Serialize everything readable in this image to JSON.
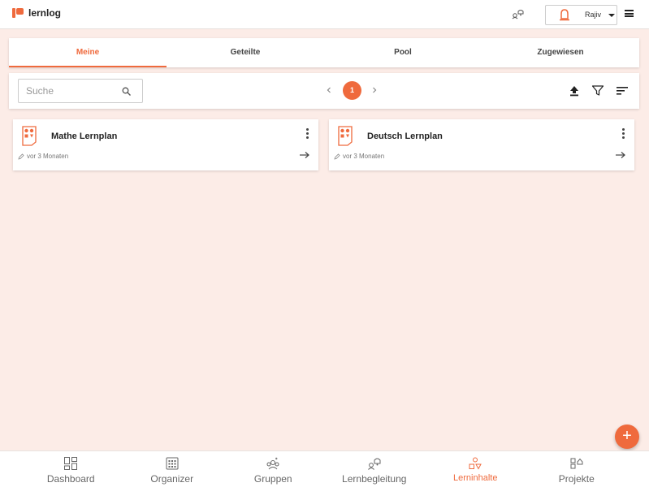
{
  "app": {
    "name": "lernlog"
  },
  "header": {
    "notification_icon": "notification-icon",
    "user_name": "Rajiv",
    "accent": "#ef6a3d"
  },
  "tabs": [
    {
      "label": "Meine",
      "active": true
    },
    {
      "label": "Geteilte",
      "active": false
    },
    {
      "label": "Pool",
      "active": false
    },
    {
      "label": "Zugewiesen",
      "active": false
    }
  ],
  "toolbar": {
    "search_placeholder": "Suche",
    "current_page": "1"
  },
  "cards": [
    {
      "title": "Mathe Lernplan",
      "updated": "vor 3 Monaten"
    },
    {
      "title": "Deutsch Lernplan",
      "updated": "vor 3 Monaten"
    }
  ],
  "fab": {
    "label": "+"
  },
  "bottom_nav": [
    {
      "label": "Dashboard",
      "icon": "dashboard-icon",
      "active": false
    },
    {
      "label": "Organizer",
      "icon": "calendar-icon",
      "active": false
    },
    {
      "label": "Gruppen",
      "icon": "groups-icon",
      "active": false
    },
    {
      "label": "Lernbegleitung",
      "icon": "mentoring-icon",
      "active": false
    },
    {
      "label": "Lerninhalte",
      "icon": "content-icon",
      "active": true
    },
    {
      "label": "Projekte",
      "icon": "projects-icon",
      "active": false
    }
  ]
}
